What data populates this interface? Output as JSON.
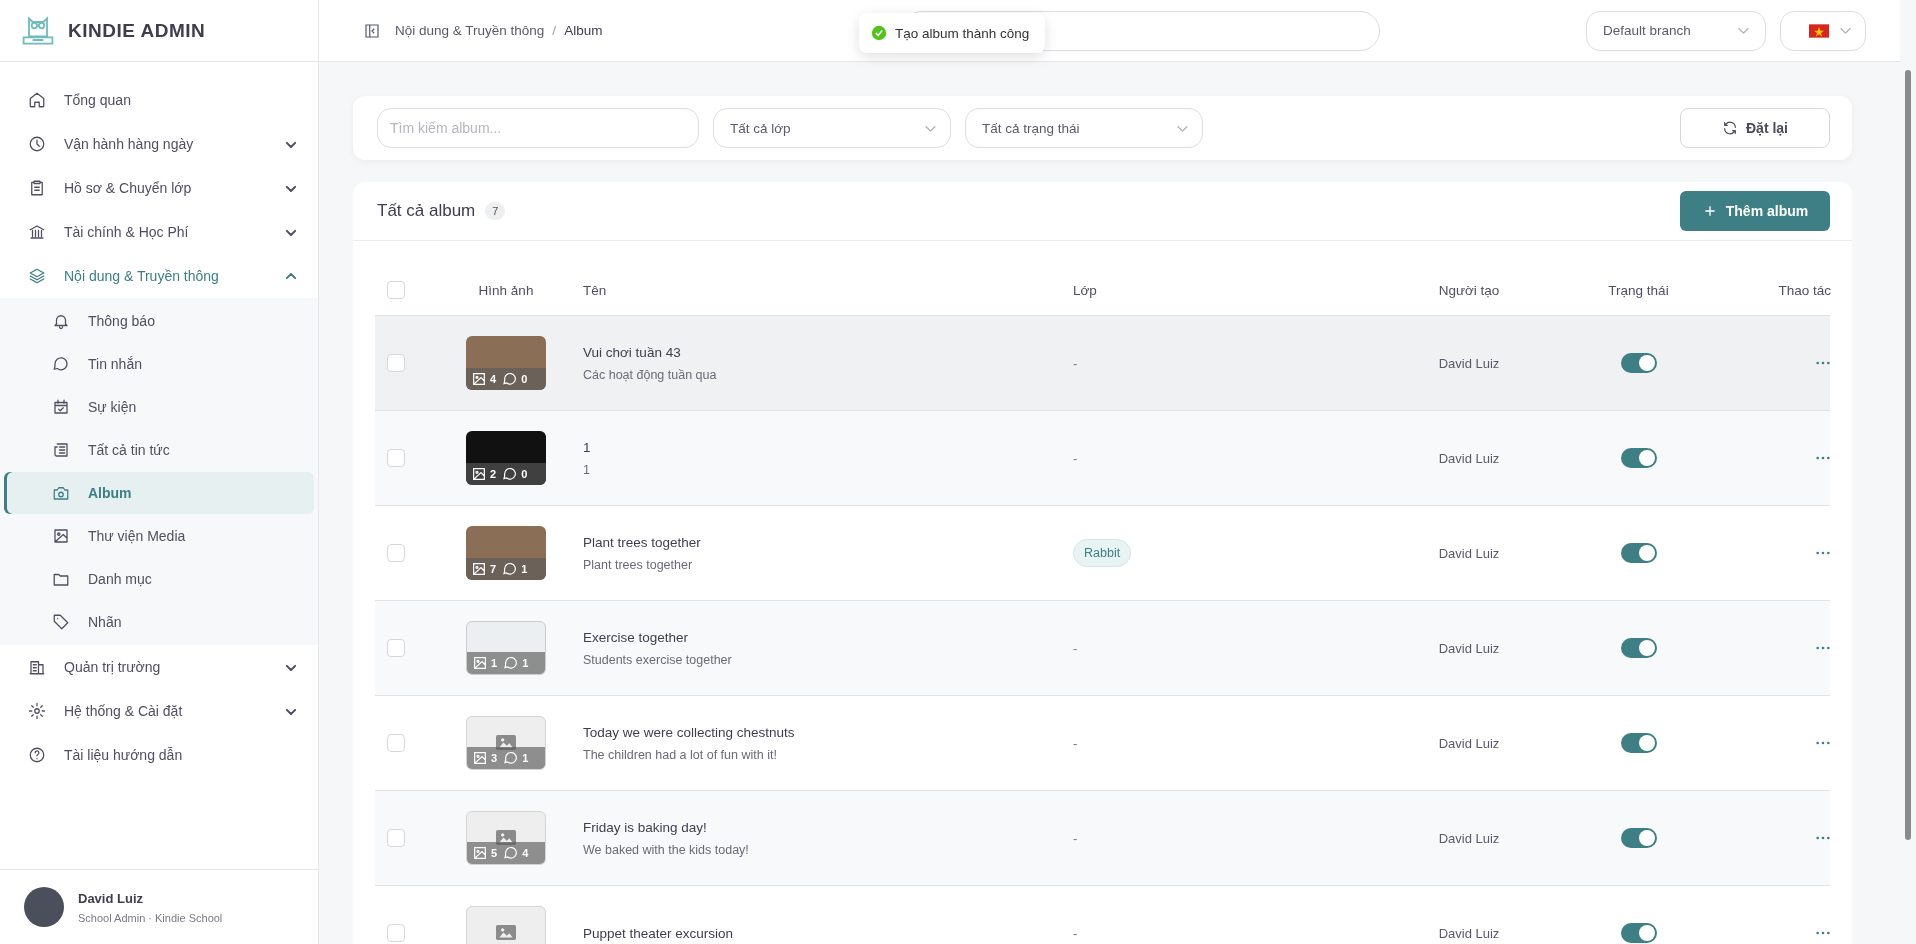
{
  "app": {
    "name": "KINDIE ADMIN"
  },
  "sidebar": {
    "items": [
      {
        "label": "Tổng quan",
        "selected": false
      },
      {
        "label": "Vận hành hàng ngày",
        "selected": false,
        "expanded": false
      },
      {
        "label": "Hồ sơ & Chuyển lớp",
        "selected": false,
        "expanded": false
      },
      {
        "label": "Tài chính & Học Phí",
        "selected": false,
        "expanded": false
      },
      {
        "label": "Nội dung & Truyền thông",
        "selected": true,
        "expanded": true,
        "children": [
          {
            "label": "Thông báo",
            "selected": false
          },
          {
            "label": "Tin nhắn",
            "selected": false
          },
          {
            "label": "Sự kiện",
            "selected": false
          },
          {
            "label": "Tất cả tin tức",
            "selected": false
          },
          {
            "label": "Album",
            "selected": true
          },
          {
            "label": "Thư viện Media",
            "selected": false
          },
          {
            "label": "Danh mục",
            "selected": false
          },
          {
            "label": "Nhãn",
            "selected": false
          }
        ]
      },
      {
        "label": "Quản trị trường",
        "selected": false,
        "expanded": false
      },
      {
        "label": "Hệ thống & Cài đặt",
        "selected": false,
        "expanded": false
      },
      {
        "label": "Tài liệu hướng dẫn",
        "selected": false
      }
    ]
  },
  "user": {
    "name": "David Luiz",
    "role": "School Admin · Kindie School"
  },
  "header": {
    "breadcrumb": [
      "Nội dung & Truyền thông",
      "Album"
    ],
    "separator": "/",
    "branch_select": {
      "value": "Default branch"
    }
  },
  "toast": {
    "message": "Tạo album thành công"
  },
  "filters": {
    "search": {
      "placeholder": "Tìm kiếm album..."
    },
    "class_select": {
      "value": "Tất cả lớp"
    },
    "status_select": {
      "value": "Tất cả trạng thái"
    },
    "reset_button": "Đặt lại"
  },
  "albums": {
    "title": "Tất cả album",
    "count": "7",
    "add_button": "Thêm album",
    "select_all": {
      "checked": false
    },
    "columns": [
      "Hình ảnh",
      "Tên",
      "Lớp",
      "Người tạo",
      "Trạng thái",
      "Thao tác"
    ],
    "rows": [
      {
        "kind": "photo",
        "photos": "4",
        "comments": "0",
        "title": "Vui chơi tuần 43",
        "description": "Các hoạt động tuần qua",
        "class": {
          "kind": "none",
          "text": "-"
        },
        "creator": "David Luiz",
        "on": true,
        "checked": false,
        "hovered": true
      },
      {
        "kind": "screenshot",
        "photos": "2",
        "comments": "0",
        "title": "1",
        "description": "1",
        "class": {
          "kind": "none",
          "text": "-"
        },
        "creator": "David Luiz",
        "on": true,
        "checked": false,
        "hovered": false
      },
      {
        "kind": "photo",
        "photos": "7",
        "comments": "1",
        "title": "Plant trees together",
        "description": "Plant trees together",
        "class": {
          "kind": "tag",
          "text": "Rabbit"
        },
        "creator": "David Luiz",
        "on": true,
        "checked": false,
        "hovered": false
      },
      {
        "kind": "document",
        "photos": "1",
        "comments": "1",
        "title": "Exercise together",
        "description": "Students exercise together",
        "class": {
          "kind": "none",
          "text": "-"
        },
        "creator": "David Luiz",
        "on": true,
        "checked": false,
        "hovered": false
      },
      {
        "kind": "empty",
        "photos": "3",
        "comments": "1",
        "title": "Today we were collecting chestnuts",
        "description": "The children had a lot of fun with it!",
        "class": {
          "kind": "none",
          "text": "-"
        },
        "creator": "David Luiz",
        "on": true,
        "checked": false,
        "hovered": false
      },
      {
        "kind": "empty",
        "photos": "5",
        "comments": "4",
        "title": "Friday is baking day!",
        "description": "We baked with the kids today!",
        "class": {
          "kind": "none",
          "text": "-"
        },
        "creator": "David Luiz",
        "on": true,
        "checked": false,
        "hovered": false
      },
      {
        "kind": "empty",
        "title": "Puppet theater excursion",
        "class": {
          "kind": "none",
          "text": "-"
        },
        "creator": "David Luiz",
        "on": true,
        "checked": false,
        "hovered": false
      }
    ]
  }
}
